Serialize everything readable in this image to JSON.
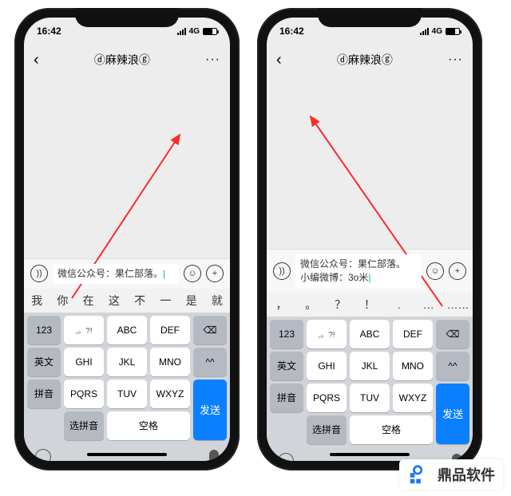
{
  "status": {
    "time": "16:42",
    "network": "4G"
  },
  "nav": {
    "title": "ⓓ麻辣浪ⓖ"
  },
  "phoneA": {
    "input": "微信公众号：果仁部落。",
    "candidates": [
      "我",
      "你",
      "在",
      "这",
      "不",
      "一",
      "是",
      "就"
    ]
  },
  "phoneB": {
    "input_line1": "微信公众号：果仁部落。",
    "input_line2": "小编微博：3o米",
    "candidates": [
      "，",
      "。",
      "？",
      "！",
      ".",
      "…",
      "……"
    ]
  },
  "keys": {
    "r1c1": "123",
    "r1c2": ",。?!",
    "r1c3": "ABC",
    "r1c4": "DEF",
    "r1c5": "⌫",
    "r2c1": "英文",
    "r2c2": "GHI",
    "r2c3": "JKL",
    "r2c4": "MNO",
    "r2c5": "^^",
    "r3c1": "拼音",
    "r3c2": "PQRS",
    "r3c3": "TUV",
    "r3c4": "WXYZ",
    "r4c2": "选拼音",
    "r4c3": "空格",
    "send": "发送"
  },
  "watermark": "鼎品软件"
}
